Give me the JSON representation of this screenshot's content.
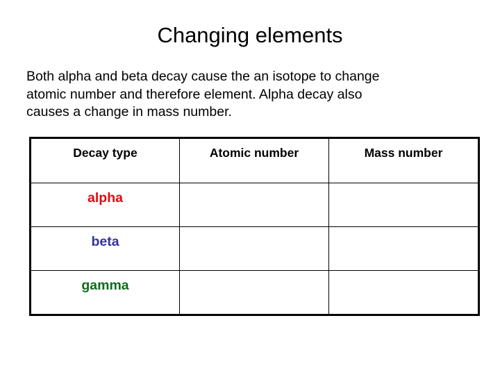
{
  "slide": {
    "title": "Changing elements",
    "body_lines": [
      "Both alpha and beta decay cause the an isotope to change",
      "atomic number and therefore element. Alpha decay also",
      "causes a change in mass number."
    ]
  },
  "table": {
    "headers": [
      "Decay type",
      "Atomic number",
      "Mass number"
    ],
    "rows": [
      {
        "decay_type": "alpha",
        "decay_type_color": "#e00b12",
        "atomic_number": "",
        "mass_number": ""
      },
      {
        "decay_type": "beta",
        "decay_type_color": "#333399",
        "atomic_number": "",
        "mass_number": ""
      },
      {
        "decay_type": "gamma",
        "decay_type_color": "#126b1e",
        "atomic_number": "",
        "mass_number": ""
      }
    ]
  },
  "colors": {
    "background": "#ffffff",
    "text": "#000000",
    "border": "#000000",
    "alpha": "#e00b12",
    "beta": "#333399",
    "gamma": "#126b1e"
  }
}
